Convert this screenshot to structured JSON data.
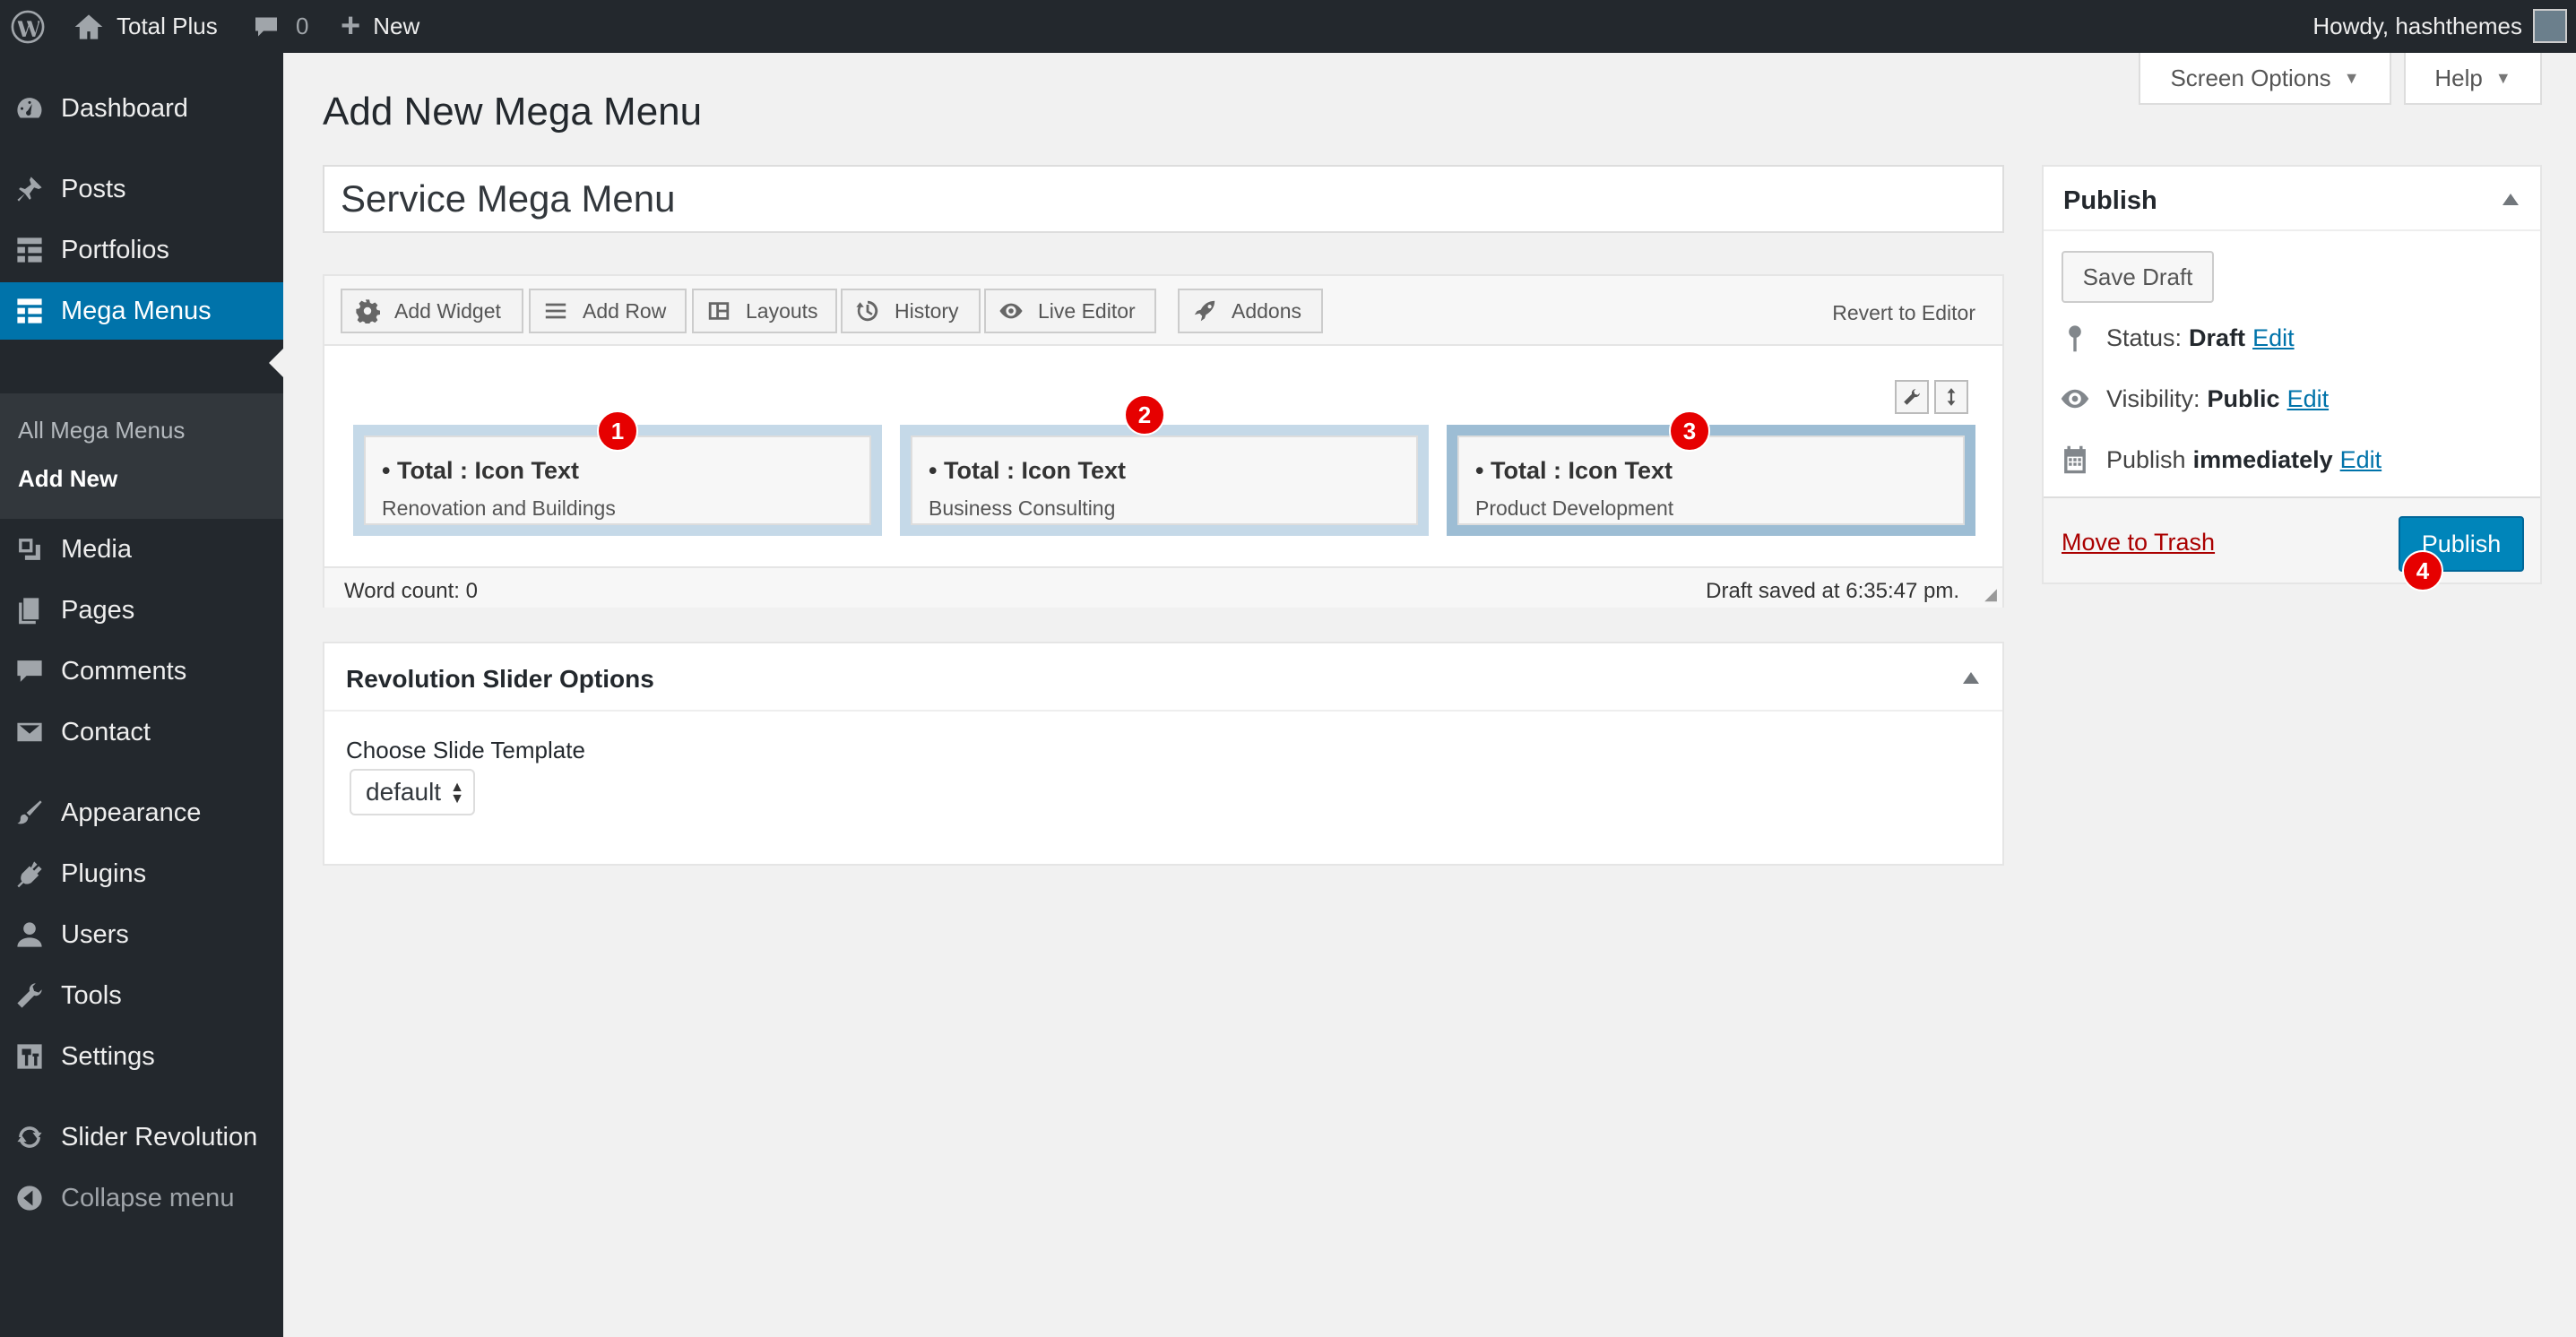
{
  "admin_bar": {
    "site_name": "Total Plus",
    "comments_count": "0",
    "new_label": "New",
    "greeting": "Howdy, hashthemes"
  },
  "sidebar": {
    "items": [
      {
        "label": "Dashboard",
        "icon": "dashboard-icon"
      },
      {
        "label": "Posts",
        "icon": "pin-icon"
      },
      {
        "label": "Portfolios",
        "icon": "grid-icon"
      },
      {
        "label": "Mega Menus",
        "icon": "grid-icon"
      },
      {
        "label": "Media",
        "icon": "media-icon"
      },
      {
        "label": "Pages",
        "icon": "pages-icon"
      },
      {
        "label": "Comments",
        "icon": "comment-icon"
      },
      {
        "label": "Contact",
        "icon": "mail-icon"
      },
      {
        "label": "Appearance",
        "icon": "brush-icon"
      },
      {
        "label": "Plugins",
        "icon": "plugin-icon"
      },
      {
        "label": "Users",
        "icon": "user-icon"
      },
      {
        "label": "Tools",
        "icon": "wrench-icon"
      },
      {
        "label": "Settings",
        "icon": "settings-icon"
      },
      {
        "label": "Slider Revolution",
        "icon": "refresh-icon"
      },
      {
        "label": "Collapse menu",
        "icon": "collapse-icon"
      }
    ],
    "submenu": [
      "All Mega Menus",
      "Add New"
    ]
  },
  "screen_options_label": "Screen Options",
  "help_label": "Help",
  "page_title": "Add New Mega Menu",
  "post_title": "Service Mega Menu",
  "builder": {
    "toolbar": [
      "Add Widget",
      "Add Row",
      "Layouts",
      "History",
      "Live Editor",
      "Addons"
    ],
    "revert_label": "Revert to Editor",
    "cells": [
      {
        "title": "Total : Icon Text",
        "subtitle": "Renovation and Buildings",
        "badge": "1"
      },
      {
        "title": "Total : Icon Text",
        "subtitle": "Business Consulting",
        "badge": "2"
      },
      {
        "title": "Total : Icon Text",
        "subtitle": "Product Development",
        "badge": "3"
      }
    ],
    "word_count": "Word count: 0",
    "draft_saved": "Draft saved at 6:35:47 pm."
  },
  "revslider": {
    "title": "Revolution Slider Options",
    "label": "Choose Slide Template",
    "selected": "default"
  },
  "publish": {
    "title": "Publish",
    "save_draft": "Save Draft",
    "status_label": "Status:",
    "status_value": "Draft",
    "visibility_label": "Visibility:",
    "visibility_value": "Public",
    "schedule_label": "Publish",
    "schedule_value": "immediately",
    "edit_label": "Edit",
    "trash_label": "Move to Trash",
    "publish_button": "Publish",
    "badge": "4"
  },
  "colors": {
    "admin_dark": "#23282d",
    "active_blue": "#0073aa",
    "publish_blue": "#0085ba",
    "badge_red": "#e60000"
  }
}
